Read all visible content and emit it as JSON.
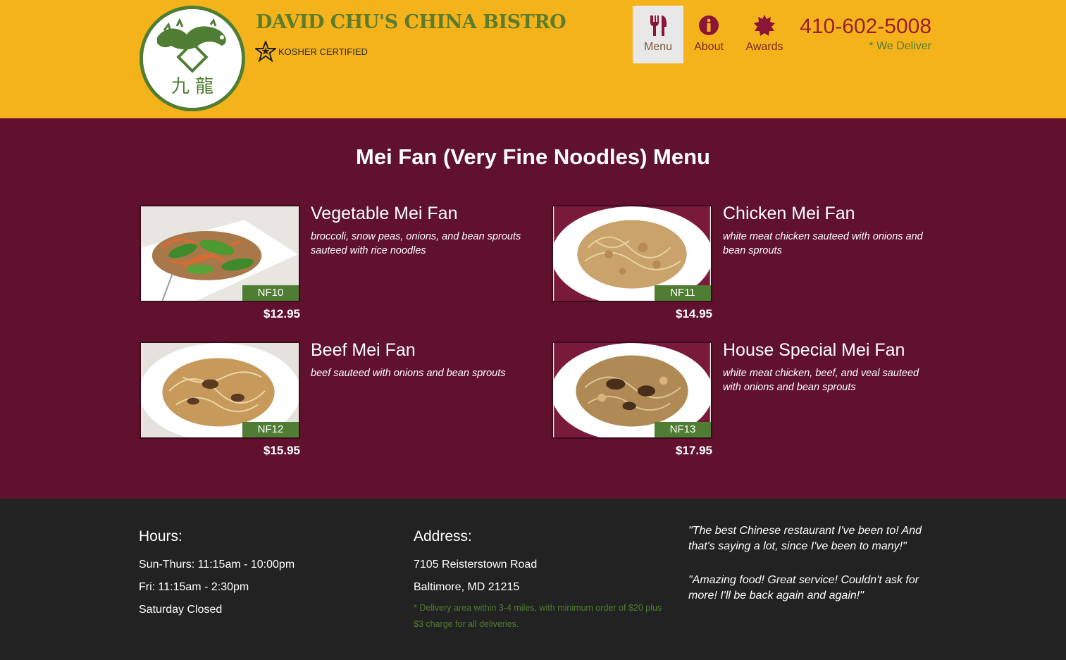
{
  "header": {
    "brand": "DAVID CHU'S CHINA BISTRO",
    "kosher": "KOSHER CERTIFIED",
    "phone": "410-602-5008",
    "deliver": "* We Deliver",
    "logo_chars": "九 龍"
  },
  "nav": {
    "menu": "Menu",
    "about": "About",
    "awards": "Awards"
  },
  "menu": {
    "title": "Mei Fan (Very Fine Noodles) Menu",
    "dishes": [
      {
        "name": "Vegetable Mei Fan",
        "desc": "broccoli, snow peas, onions, and bean sprouts sauteed with rice noodles",
        "code": "NF10",
        "price": "$12.95"
      },
      {
        "name": "Chicken Mei Fan",
        "desc": "white meat chicken sauteed with onions and bean sprouts",
        "code": "NF11",
        "price": "$14.95"
      },
      {
        "name": "Beef Mei Fan",
        "desc": "beef sauteed with onions and bean sprouts",
        "code": "NF12",
        "price": "$15.95"
      },
      {
        "name": "House Special Mei Fan",
        "desc": "white meat chicken, beef, and veal sauteed with onions and bean sprouts",
        "code": "NF13",
        "price": "$17.95"
      }
    ]
  },
  "footer": {
    "hours": {
      "title": "Hours:",
      "lines": [
        "Sun-Thurs: 11:15am - 10:00pm",
        "Fri: 11:15am - 2:30pm",
        "Saturday Closed"
      ]
    },
    "address": {
      "title": "Address:",
      "street": "7105 Reisterstown Road",
      "city": "Baltimore, MD 21215",
      "note": "* Delivery area within 3-4 miles, with minimum order of $20 plus $3 charge for all deliveries."
    },
    "quotes": [
      "\"The best Chinese restaurant I've been to! And that's saying a lot, since I've been to many!\"",
      "\"Amazing food! Great service! Couldn't ask for more! I'll be back again and again!\""
    ]
  },
  "colors": {
    "header_bg": "#F4B31A",
    "menu_bg": "#5f112e",
    "footer_bg": "#222222",
    "accent_green": "#4f7d33",
    "accent_red": "#9a1e2c"
  },
  "icons": {
    "logo": "dragon-logo-icon",
    "kosher": "star-icon",
    "menu": "fork-knife-icon",
    "about": "info-icon",
    "awards": "badge-icon"
  }
}
